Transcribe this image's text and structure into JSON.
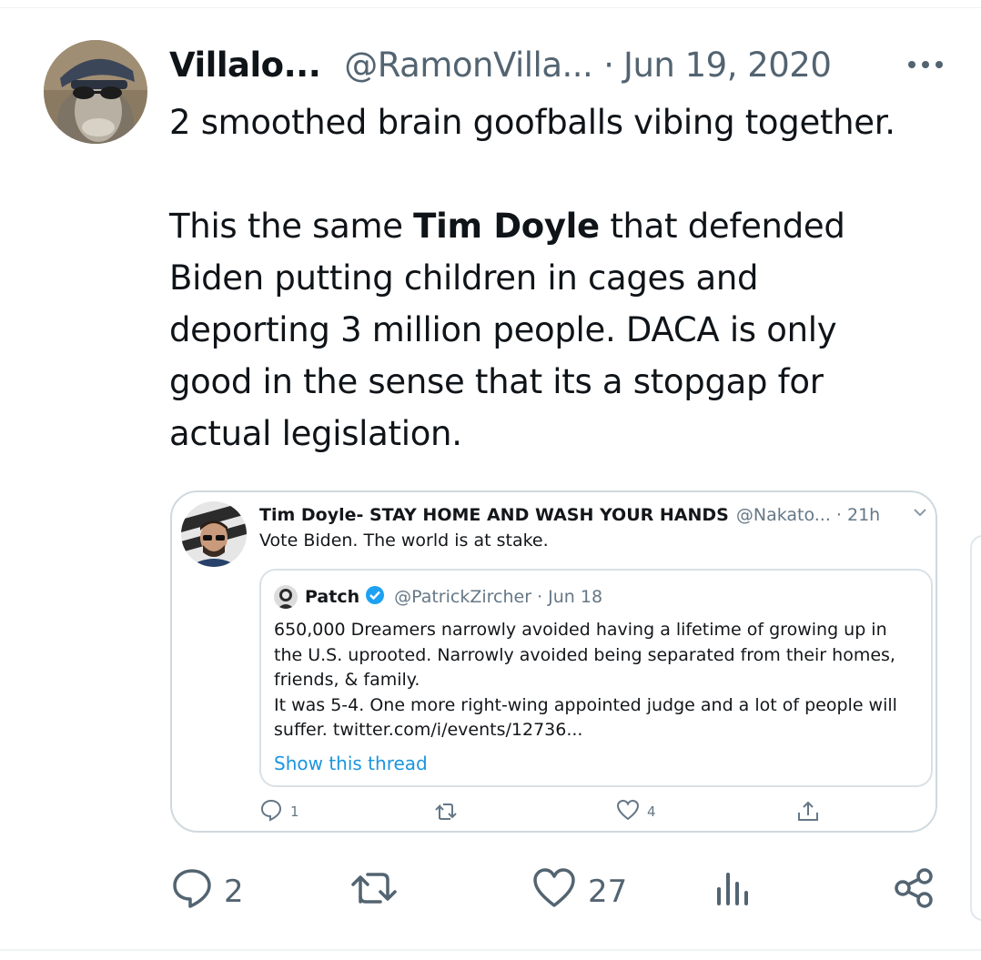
{
  "tweet": {
    "author_name": "Villalo...",
    "author_handle": "@RamonVilla...",
    "separator": "·",
    "date": "Jun 19, 2020",
    "body_line1": "2 smoothed brain goofballs vibing together.",
    "body_p2_prefix": "This the same ",
    "body_p2_bold": "Tim Doyle",
    "body_p2_rest1": " that defended",
    "body_p2_line2": "Biden putting children in cages and",
    "body_p2_line3": "deporting 3 million people. DACA is only",
    "body_p2_line4": "good in the sense that its a stopgap for",
    "body_p2_line5": "actual legislation.",
    "stats": {
      "replies": "2",
      "likes": "27"
    }
  },
  "embedded": {
    "author_name": "Tim Doyle- STAY HOME AND WASH YOUR HANDS",
    "author_handle": "@Nakato... · 21h",
    "text": "Vote Biden. The world is at stake.",
    "stats": {
      "replies": "1",
      "likes": "4"
    },
    "quote": {
      "author_name": "Patch",
      "author_handle": "@PatrickZircher · Jun 18",
      "line1": "650,000 Dreamers narrowly avoided having a lifetime of growing up in",
      "line2": "the U.S. uprooted. Narrowly avoided being separated from their homes,",
      "line3": "friends, & family.",
      "line4": "It was 5-4. One more right-wing appointed judge and a lot of people will",
      "line5": "suffer. twitter.com/i/events/12736...",
      "show_thread": "Show this thread"
    }
  },
  "icons": {
    "more": "more-dots-icon",
    "reply": "reply-icon",
    "retweet": "retweet-icon",
    "like": "heart-icon",
    "views": "views-icon",
    "share": "share-icon"
  },
  "colors": {
    "text": "#0f1419",
    "secondary": "#536471",
    "link": "#1b95e0",
    "verified": "#1da1f2"
  }
}
